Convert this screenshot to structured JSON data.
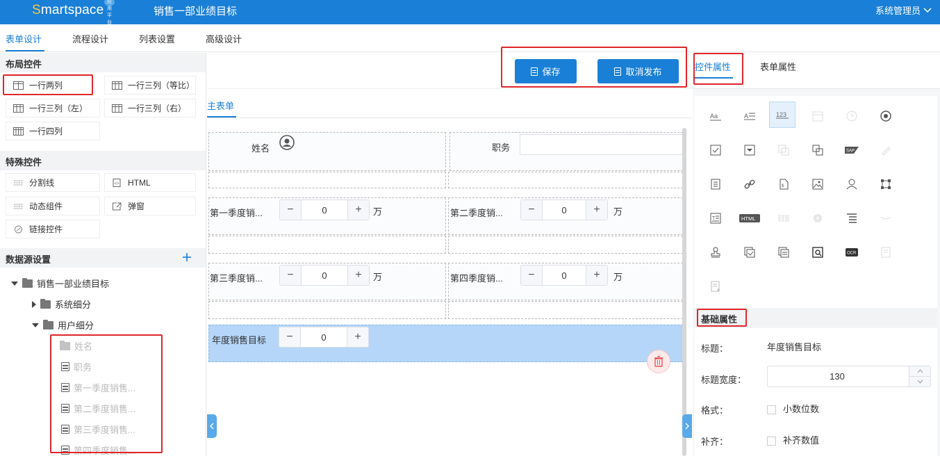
{
  "header": {
    "logo": "Smartspace",
    "logo_badge": "应用平台",
    "title": "销售一部业绩目标",
    "user": "系统管理员"
  },
  "tabs": [
    "表单设计",
    "流程设计",
    "列表设置",
    "高级设计"
  ],
  "left": {
    "layout_title": "布局控件",
    "layout_items": [
      "一行两列",
      "一行三列（等比）",
      "一行三列（左）",
      "一行三列（右）",
      "一行四列"
    ],
    "special_title": "特殊控件",
    "special_items": [
      "分割线",
      "HTML",
      "动态组件",
      "弹窗",
      "链接控件"
    ],
    "datasource_title": "数据源设置",
    "tree": {
      "root": "销售一部业绩目标",
      "system": "系统细分",
      "user": "用户细分",
      "fields": [
        "姓名",
        "职务",
        "第一季度销售...",
        "第二季度销售...",
        "第三季度销售...",
        "第四季度销售..."
      ]
    }
  },
  "toolbar": {
    "save": "保存",
    "unpublish": "取消发布"
  },
  "form": {
    "tab": "主表单",
    "name_label": "姓名",
    "position_label": "职务",
    "q1_label": "第一季度销...",
    "q2_label": "第二季度销...",
    "q3_label": "第三季度销...",
    "q4_label": "第四季度销...",
    "unit": "万",
    "q1_value": "0",
    "q2_value": "0",
    "q3_value": "0",
    "q4_value": "0",
    "annual_label": "年度销售目标",
    "annual_value": "0"
  },
  "right": {
    "tabs": [
      "控件属性",
      "表单属性"
    ],
    "icons": [
      "text-label-icon",
      "text-area-icon",
      "number-icon",
      "date-icon",
      "time-icon",
      "radio-icon",
      "checkbox-icon",
      "dropdown-icon",
      "copy-icon",
      "multi-select-icon",
      "sap-icon",
      "signature-icon",
      "document-icon",
      "link-icon",
      "attachment-icon",
      "image-icon",
      "user-icon",
      "org-chart-icon",
      "rich-text-icon",
      "html-icon",
      "barcode-icon",
      "plus-circle-icon",
      "list-icon",
      "divider-icon",
      "stamp-icon",
      "approve-icon",
      "sub-form-icon",
      "preview-icon",
      "ocr-icon",
      "report-icon",
      "add-form-icon"
    ],
    "basic_title": "基础属性",
    "title_label": "标题：",
    "title_value": "年度销售目标",
    "title_width_label": "标题宽度：",
    "title_width_value": "130",
    "format_label": "格式：",
    "decimal_label": "小数位数",
    "pad_label": "补齐：",
    "pad_option": "补齐数值"
  },
  "colors": {
    "primary": "#1a7fd6",
    "highlight": "#e0262b",
    "selected": "#b5d6f8"
  }
}
